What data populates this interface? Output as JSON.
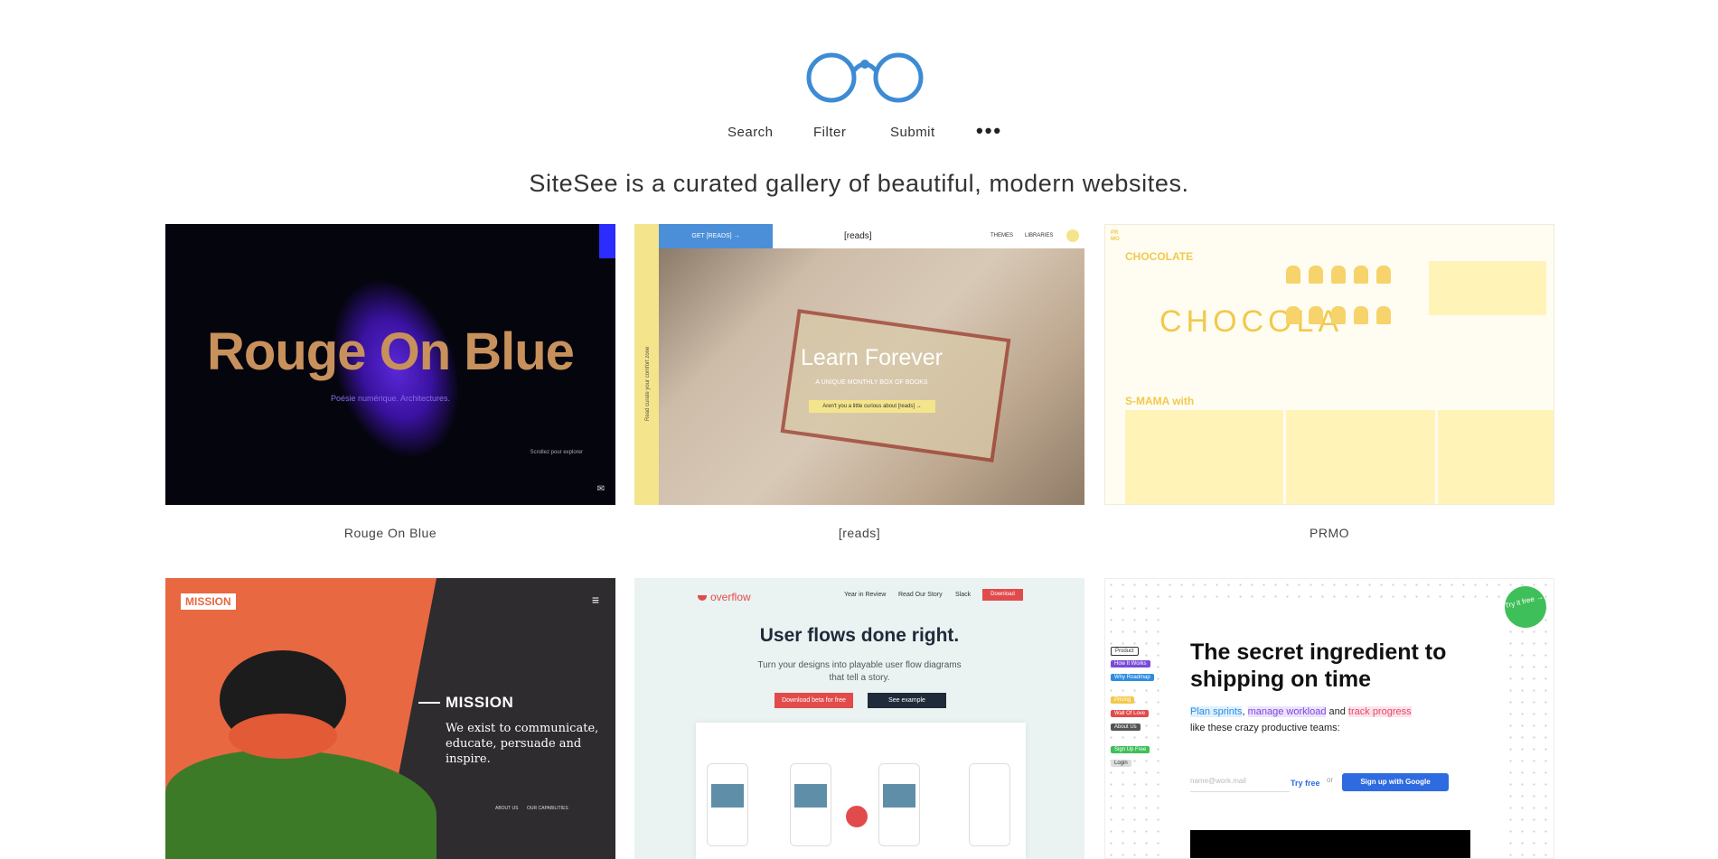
{
  "header": {
    "nav": [
      "Search",
      "Filter",
      "Submit"
    ],
    "more": "•••",
    "tagline": "SiteSee is a curated gallery of beautiful, modern websites."
  },
  "cards": [
    {
      "caption": "Rouge On Blue",
      "preview": {
        "headline": "Rouge On Blue",
        "subtitle": "Poésie numérique. Architectures.",
        "scroll": "Scrollez pour explorer"
      }
    },
    {
      "caption": "[reads]",
      "preview": {
        "get": "GET [READS] →",
        "brand": "[reads]",
        "themes": "THEMES",
        "libraries": "LIBRARIES",
        "side": "Read curate your comfort zone",
        "headline": "Learn Forever",
        "subtitle": "A UNIQUE MONTHLY BOX OF BOOKS",
        "cta": "Aren't you a little curious about [reads] →"
      }
    },
    {
      "caption": "PRMO",
      "preview": {
        "logo": "PR MO",
        "headline": "CHOCOLATE",
        "big": "CHOCOLA",
        "section": "S-MAMA with"
      }
    },
    {
      "caption": "",
      "preview": {
        "badge": "MISSION",
        "menu": "≡",
        "title": "MISSION",
        "text": "We exist to communicate, educate, persuade and inspire.",
        "link1": "ABOUT US",
        "link2": "OUR CAPABILITIES"
      }
    },
    {
      "caption": "",
      "preview": {
        "logo": "overflow",
        "nav": [
          "Year in Review",
          "Read Our Story",
          "Slack"
        ],
        "download": "Download",
        "headline": "User flows done right.",
        "text": "Turn your designs into playable user flow diagrams that tell a story.",
        "btn1": "Download beta for free",
        "btn2": "See example"
      }
    },
    {
      "caption": "",
      "preview": {
        "headline": "The secret ingredient to shipping on time",
        "hl1": "Plan sprints",
        "sep1": ", ",
        "hl2": "manage workload",
        "sep2": " and ",
        "hl3": "track progress",
        "line2": "like these crazy productive teams:",
        "placeholder": "name@work.mail",
        "try": "Try free",
        "or": "or",
        "google": "Sign up with Google",
        "badge": "Try it free →",
        "tags": [
          "Product",
          "How It Works",
          "Why Roadmap",
          "Pricing",
          "Wall Of Love",
          "About Us",
          "Sign Up Free",
          "Login"
        ]
      }
    }
  ],
  "colors": {
    "accent": "#3d8bd4",
    "tag_colors": [
      "#ffffff",
      "#7a4ad8",
      "#2e8de0",
      "#f2c94c",
      "#e24b4b",
      "#555555",
      "#3fbf5a",
      "#dddddd"
    ]
  }
}
